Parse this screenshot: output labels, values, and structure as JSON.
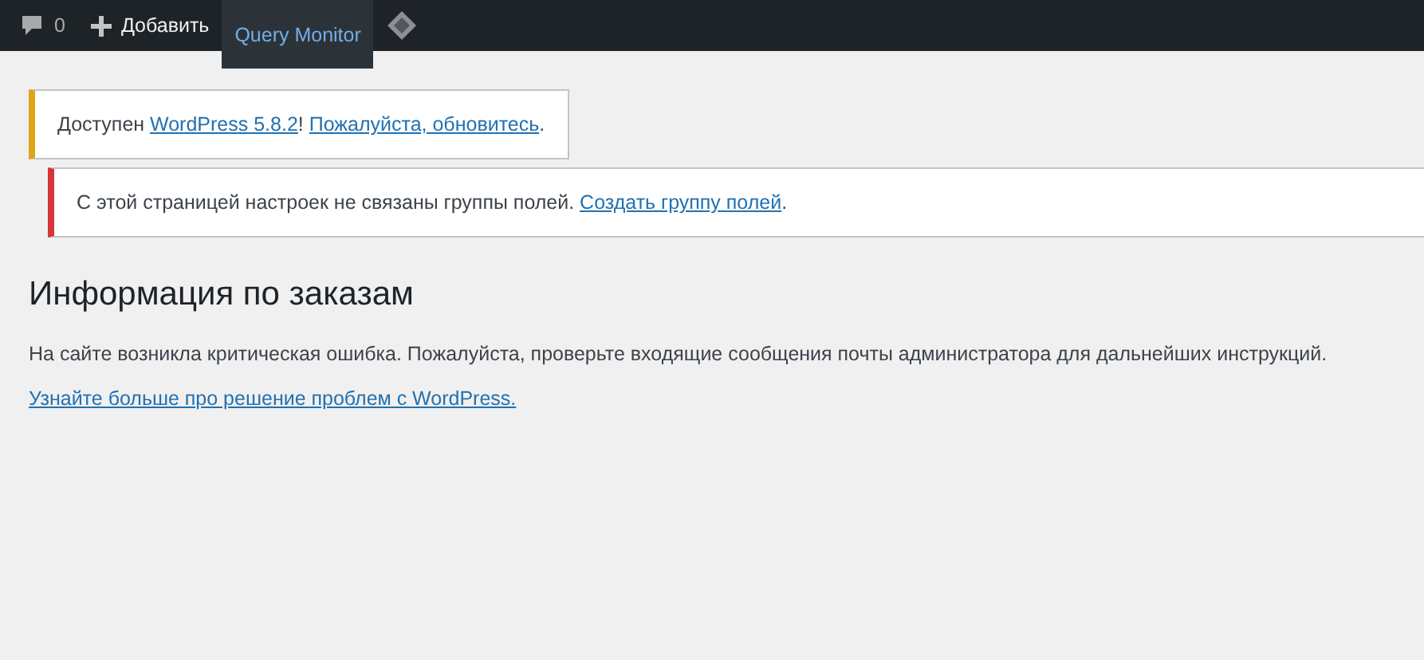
{
  "admin_bar": {
    "items": [
      {
        "kind": "comments",
        "label": "0",
        "selected": false
      },
      {
        "kind": "add",
        "label": "Добавить",
        "selected": false
      },
      {
        "kind": "text",
        "label": "Query Monitor",
        "selected": true
      },
      {
        "kind": "diamond",
        "selected": false
      }
    ]
  },
  "notices": [
    {
      "color": "#dba617",
      "indent": false,
      "parts": [
        {
          "kind": "text",
          "text": "Доступен "
        },
        {
          "kind": "link",
          "text": "WordPress 5.8.2"
        },
        {
          "kind": "text",
          "text": "! "
        },
        {
          "kind": "link",
          "text": "Пожалуйста, обновитесь"
        },
        {
          "kind": "text",
          "text": "."
        }
      ]
    },
    {
      "color": "#d63638",
      "indent": true,
      "parts": [
        {
          "kind": "text",
          "text": "С этой страницей настроек не связаны группы полей. "
        },
        {
          "kind": "link",
          "text": "Создать группу полей"
        },
        {
          "kind": "text",
          "text": "."
        }
      ]
    }
  ],
  "page": {
    "title": "Информация по заказам",
    "message": "На сайте возникла критическая ошибка. Пожалуйста, проверьте входящие сообщения почты администратора для дальнейших инструкций.",
    "link": "Узнайте больше про решение проблем с WordPress."
  }
}
